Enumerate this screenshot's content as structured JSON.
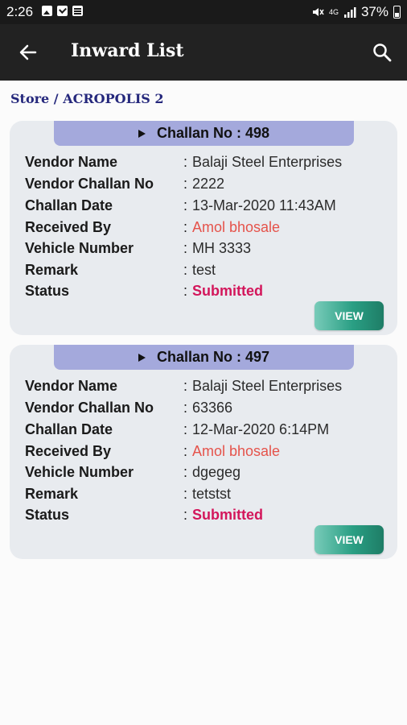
{
  "status_bar": {
    "time": "2:26",
    "network": "4G",
    "battery": "37%"
  },
  "app_bar": {
    "title": "Inward List"
  },
  "breadcrumb": "Store / ACROPOLIS 2",
  "colors": {
    "header_bg": "#222222",
    "card_header": "#a4a9dc",
    "received_by": "#e5534b",
    "status": "#d3165b",
    "view_button": "#2a9f84"
  },
  "labels": {
    "vendor_name": "Vendor Name",
    "vendor_challan_no": "Vendor Challan No",
    "challan_date": "Challan Date",
    "received_by": "Received By",
    "vehicle_number": "Vehicle Number",
    "remark": "Remark",
    "status": "Status",
    "view": "VIEW"
  },
  "challans": [
    {
      "title": "Challan No : 498",
      "vendor_name": "Balaji Steel Enterprises",
      "vendor_challan_no": "2222",
      "challan_date": "13-Mar-2020 11:43AM",
      "received_by": "Amol bhosale",
      "vehicle_number": "MH 3333",
      "remark": "test",
      "status": "Submitted"
    },
    {
      "title": "Challan No : 497",
      "vendor_name": "Balaji Steel Enterprises",
      "vendor_challan_no": "63366",
      "challan_date": "12-Mar-2020 6:14PM",
      "received_by": "Amol bhosale",
      "vehicle_number": "dgegeg",
      "remark": "tetstst",
      "status": "Submitted"
    }
  ]
}
